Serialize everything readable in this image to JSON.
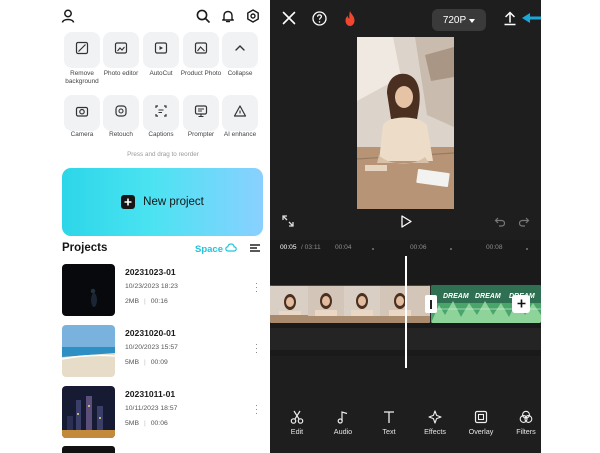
{
  "left": {
    "tools": [
      {
        "label": "Remove background",
        "icon": "remove-background-icon"
      },
      {
        "label": "Photo editor",
        "icon": "photo-editor-icon"
      },
      {
        "label": "AutoCut",
        "icon": "autocut-icon"
      },
      {
        "label": "Product Photo",
        "icon": "product-photo-icon"
      },
      {
        "label": "Collapse",
        "icon": "chevron-up-icon"
      },
      {
        "label": "Camera",
        "icon": "camera-icon"
      },
      {
        "label": "Retouch",
        "icon": "retouch-icon"
      },
      {
        "label": "Captions",
        "icon": "captions-icon"
      },
      {
        "label": "Prompter",
        "icon": "prompter-icon"
      },
      {
        "label": "AI enhance",
        "icon": "ai-enhance-icon"
      }
    ],
    "hint": "Press and drag to reorder",
    "new_project_label": "New project",
    "projects_heading": "Projects",
    "space_label": "Space",
    "projects": [
      {
        "name": "20231023-01",
        "date": "10/23/2023 18:23",
        "size": "2MB",
        "duration": "00:16"
      },
      {
        "name": "20231020-01",
        "date": "10/20/2023 15:57",
        "size": "5MB",
        "duration": "00:09"
      },
      {
        "name": "20231011-01",
        "date": "10/11/2023 18:57",
        "size": "5MB",
        "duration": "00:06"
      }
    ]
  },
  "right": {
    "resolution": "720P",
    "timecode_current": "00:05",
    "timecode_total": "/ 03:11",
    "ticks": [
      "00:04",
      "00:06",
      "00:08"
    ],
    "clip_text": "DREAM",
    "toolbar": [
      {
        "label": "Edit",
        "icon": "scissors-icon"
      },
      {
        "label": "Audio",
        "icon": "music-note-icon"
      },
      {
        "label": "Text",
        "icon": "text-icon"
      },
      {
        "label": "Effects",
        "icon": "sparkle-icon"
      },
      {
        "label": "Overlay",
        "icon": "overlay-icon"
      },
      {
        "label": "Filters",
        "icon": "filters-icon"
      }
    ]
  },
  "colors": {
    "accent": "#20c5de",
    "editor_bg": "#1e1e1e",
    "flame": "#f0452e",
    "pointer_arrow": "#1aa7d8"
  }
}
